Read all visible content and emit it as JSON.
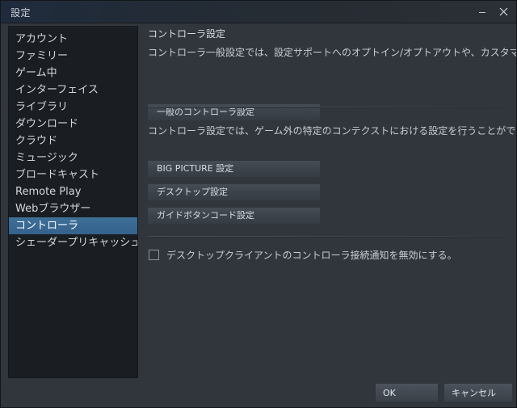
{
  "window": {
    "title": "設定",
    "controls": [
      {
        "name": "minimize",
        "glyph": "–"
      },
      {
        "name": "close",
        "glyph": "✕"
      }
    ]
  },
  "sidebar": {
    "selected": "コントローラ",
    "items": [
      {
        "label": "アカウント"
      },
      {
        "label": "ファミリー"
      },
      {
        "label": "ゲーム中"
      },
      {
        "label": "インターフェイス"
      },
      {
        "label": "ライブラリ"
      },
      {
        "label": "ダウンロード"
      },
      {
        "label": "クラウド"
      },
      {
        "label": "ミュージック"
      },
      {
        "label": "ブロードキャスト"
      },
      {
        "label": "Remote Play"
      },
      {
        "label": "Webブラウザー"
      },
      {
        "label": "コントローラ"
      },
      {
        "label": "シェーダープリキャッシュ"
      }
    ]
  },
  "content": {
    "section_title": "コントローラ設定",
    "description_general": "コントローラ一般設定では、設定サポートへのオプトイン/オプトアウトや、カスタマイズなどのオプションを設定できます。",
    "button_general": "一般のコントローラ設定",
    "description_context": "コントローラ設定では、ゲーム外の特定のコンテクストにおける設定を行うことができます。",
    "button_bigpicture": "BIG PICTURE 設定",
    "button_desktop": "デスクトップ設定",
    "button_guide": "ガイドボタンコード設定",
    "checkbox_label": "デスクトップクライアントのコントローラ接続通知を無効にする。",
    "checkbox_checked": false
  },
  "footer": {
    "ok_label": "OK",
    "cancel_label": "キャンセル"
  },
  "colors": {
    "window_bg": "#31363d",
    "titlebar_left": "#1f2b3d",
    "sidebar_bg": "#1a1d21",
    "selection": "#3a6a9a",
    "text_primary": "#d3d8de",
    "text_secondary": "#c6ccd3",
    "button_face": "#434951"
  }
}
